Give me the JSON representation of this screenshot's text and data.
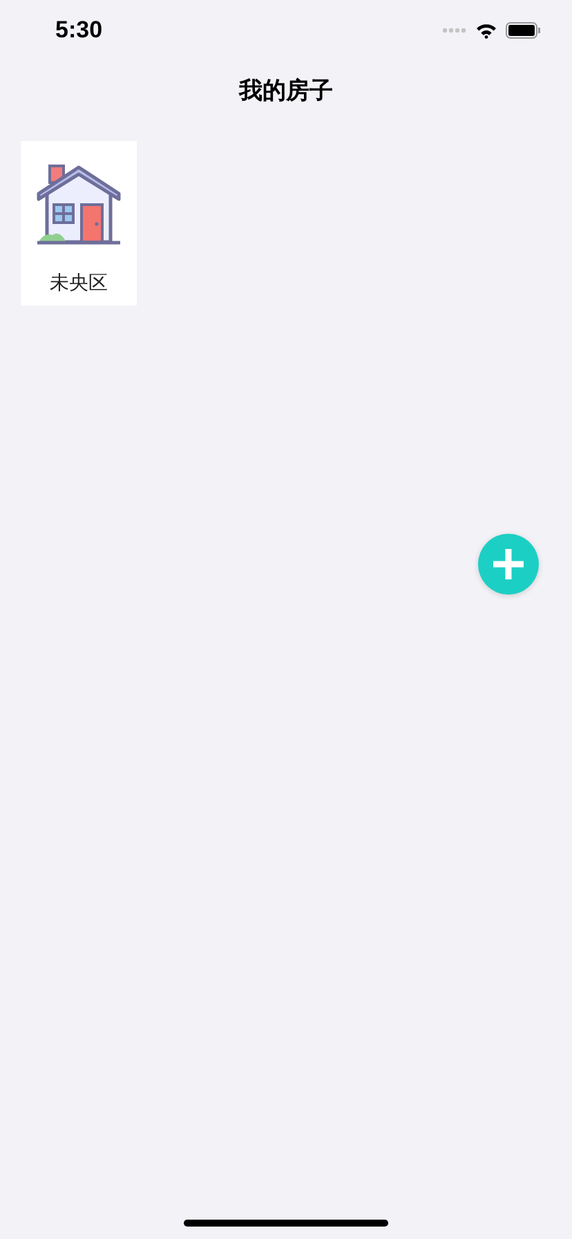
{
  "status_bar": {
    "time": "5:30"
  },
  "title": "我的房子",
  "houses": [
    {
      "name": "未央区"
    }
  ]
}
